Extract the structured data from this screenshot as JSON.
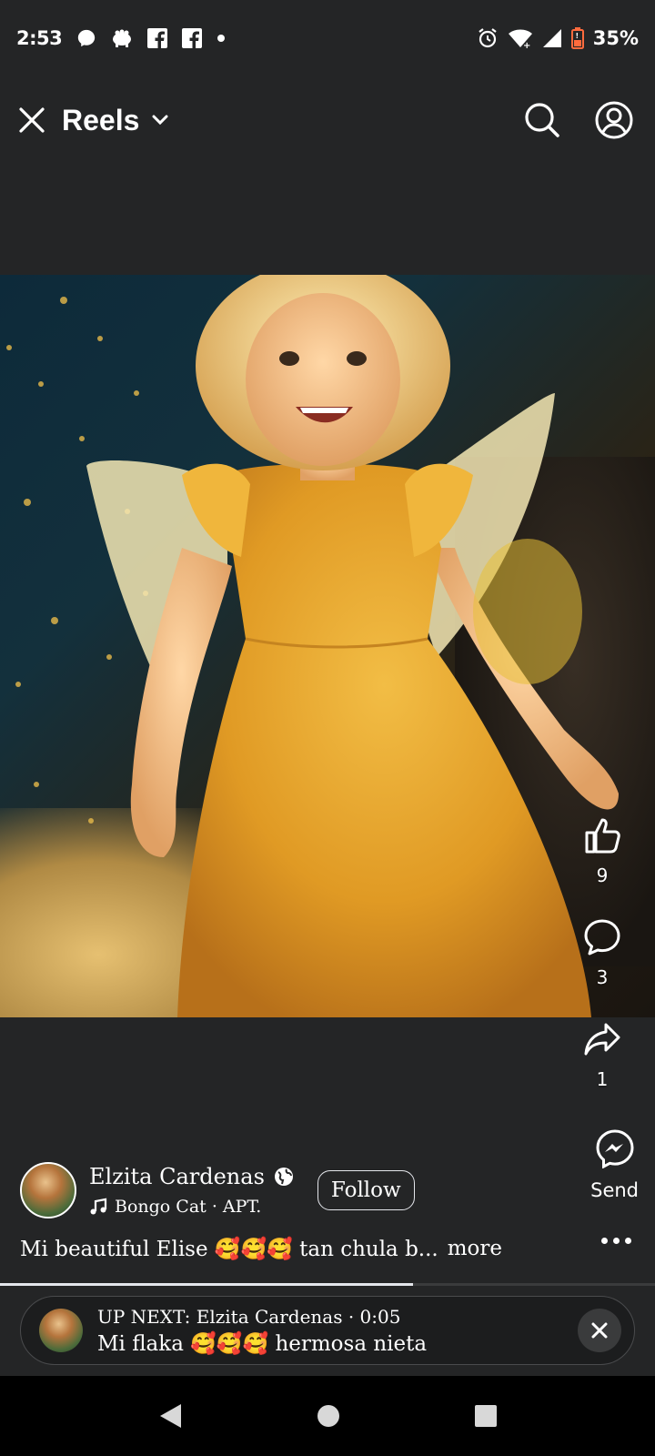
{
  "status_bar": {
    "time": "2:53",
    "battery": "35%",
    "icons": [
      "messenger-icon",
      "pig-icon",
      "facebook-icon",
      "facebook-icon",
      "dot-icon",
      "alarm-icon",
      "wifi-icon",
      "signal-icon",
      "battery-icon"
    ]
  },
  "header": {
    "title": "Reels",
    "icons": [
      "close-icon",
      "chevron-down-icon",
      "search-icon",
      "profile-icon"
    ]
  },
  "reel": {
    "likes": "9",
    "comments": "3",
    "shares": "1",
    "send_label": "Send",
    "author": "Elzita Cardenas",
    "audio": "Bongo Cat · APT.",
    "follow_label": "Follow",
    "caption": "Mi beautiful Elise 🥰🥰🥰 tan chula b...",
    "more_label": "more",
    "progress": 0.63
  },
  "up_next": {
    "line1": "UP NEXT: Elzita Cardenas · 0:05",
    "line2": "Mi flaka 🥰🥰🥰 hermosa nieta"
  },
  "colors": {
    "background": "#242526",
    "dress": "#e3a52c",
    "text": "#ffffff"
  }
}
